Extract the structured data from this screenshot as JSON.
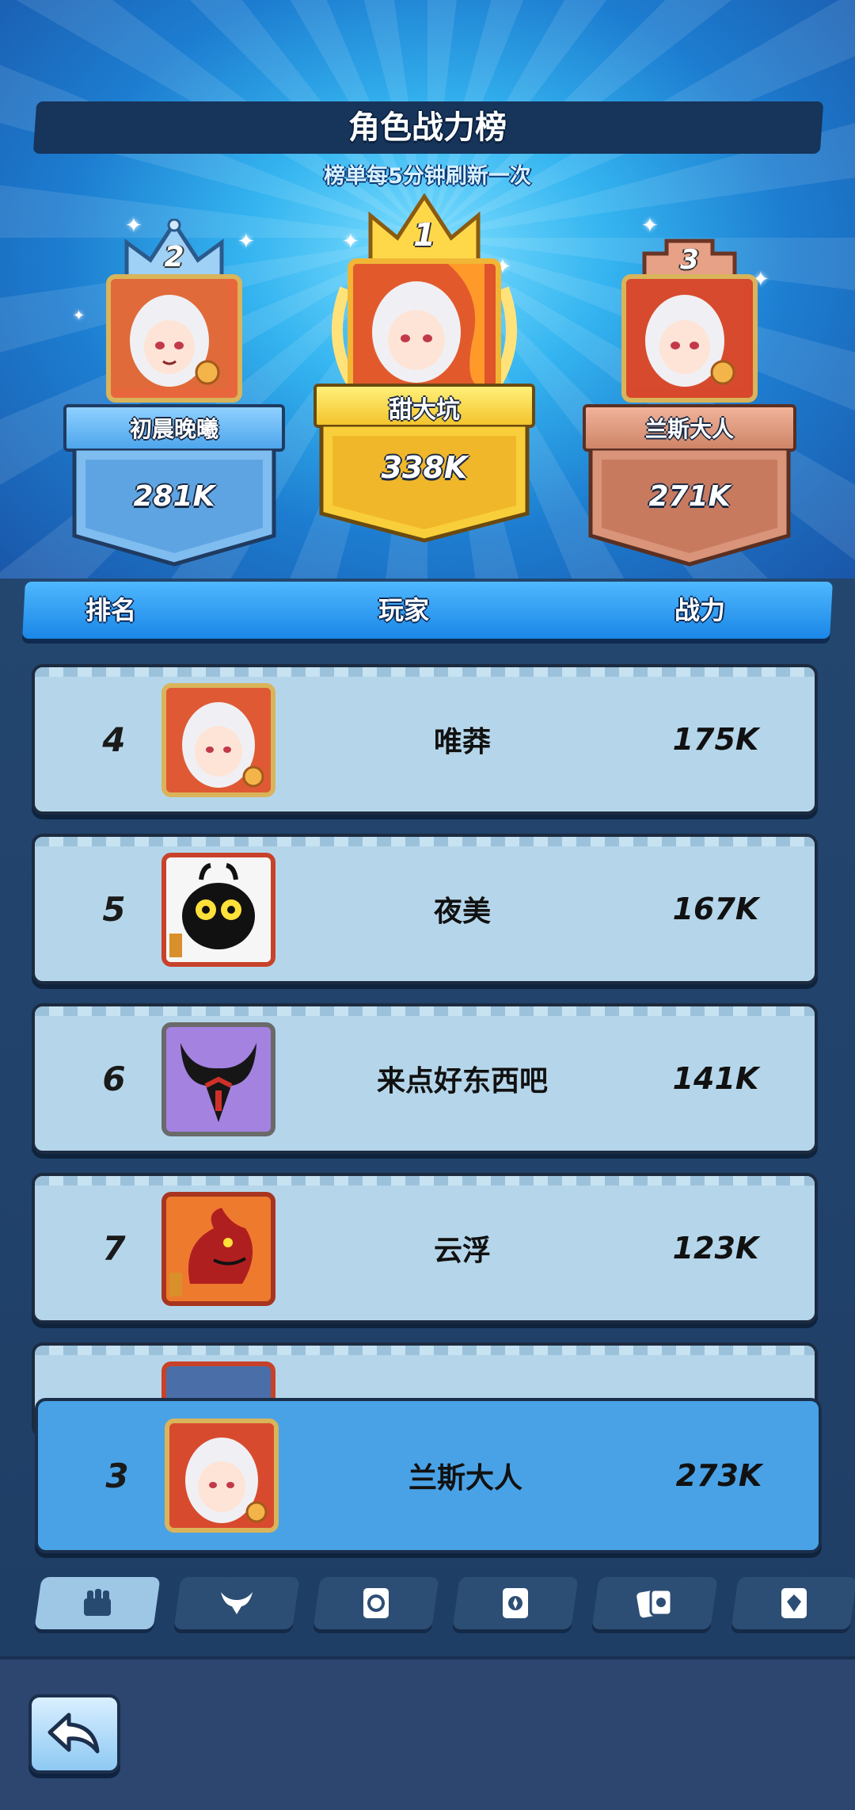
{
  "header": {
    "title": "角色战力榜",
    "subtitle": "榜单每5分钟刷新一次"
  },
  "podium": [
    {
      "rank": "1",
      "name": "甜大坑",
      "power": "338K"
    },
    {
      "rank": "2",
      "name": "初晨晚曦",
      "power": "281K"
    },
    {
      "rank": "3",
      "name": "兰斯大人",
      "power": "271K"
    }
  ],
  "columns": {
    "rank": "排名",
    "player": "玩家",
    "power": "战力"
  },
  "rows": [
    {
      "rank": "4",
      "name": "唯莽",
      "power": "175K",
      "avatar": "elf-girl-avatar"
    },
    {
      "rank": "5",
      "name": "夜美",
      "power": "167K",
      "avatar": "black-slime-avatar"
    },
    {
      "rank": "6",
      "name": "来点好东西吧",
      "power": "141K",
      "avatar": "horned-demon-avatar"
    },
    {
      "rank": "7",
      "name": "云浮",
      "power": "123K",
      "avatar": "red-dragon-avatar"
    }
  ],
  "self_row": {
    "rank": "3",
    "name": "兰斯大人",
    "power": "273K"
  },
  "tabs": [
    {
      "icon": "fist-icon",
      "active": true
    },
    {
      "icon": "bull-horns-icon",
      "active": false
    },
    {
      "icon": "spiral-card-icon",
      "active": false
    },
    {
      "icon": "compass-card-icon",
      "active": false
    },
    {
      "icon": "pair-cards-icon",
      "active": false
    },
    {
      "icon": "gem-card-icon",
      "active": false
    }
  ],
  "back_button": {
    "icon": "back-arrow-icon"
  },
  "colors": {
    "gold": "#f7c531",
    "silver": "#6fb6f0",
    "bronze": "#d98f74",
    "row_bg": "#b5d6ea",
    "self_row_bg": "#49a2e6"
  }
}
